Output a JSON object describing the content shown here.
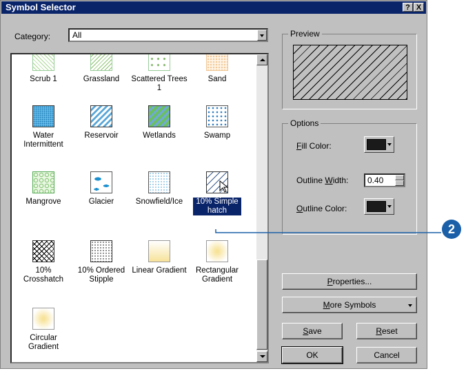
{
  "window": {
    "title": "Symbol Selector",
    "help_btn": "?",
    "close_btn": "X"
  },
  "category": {
    "label": "Category:",
    "value": "All"
  },
  "symbols": [
    {
      "label": "Scrub 1"
    },
    {
      "label": "Grassland"
    },
    {
      "label": "Scattered Trees 1"
    },
    {
      "label": "Sand"
    },
    {
      "label": "Water Intermittent"
    },
    {
      "label": "Reservoir"
    },
    {
      "label": "Wetlands"
    },
    {
      "label": "Swamp"
    },
    {
      "label": "Mangrove"
    },
    {
      "label": "Glacier"
    },
    {
      "label": "Snowfield/Ice"
    },
    {
      "label": "10% Simple hatch"
    },
    {
      "label": "10% Crosshatch"
    },
    {
      "label": "10% Ordered Stipple"
    },
    {
      "label": "Linear Gradient"
    },
    {
      "label": "Rectangular Gradient"
    },
    {
      "label": "Circular Gradient"
    }
  ],
  "selected_symbol": "10% Simple hatch",
  "preview": {
    "caption": "Preview"
  },
  "options": {
    "caption": "Options",
    "fill_color": {
      "label_pre": "",
      "label_key": "F",
      "label_post": "ill Color:",
      "color": "#1a1a1a"
    },
    "outline_width": {
      "label_pre": "Outline ",
      "label_key": "W",
      "label_post": "idth:",
      "value": "0.40"
    },
    "outline_color": {
      "label_pre": "",
      "label_key": "O",
      "label_post": "utline Color:",
      "color": "#1a1a1a"
    }
  },
  "buttons": {
    "properties": {
      "pre": "",
      "key": "P",
      "post": "roperties..."
    },
    "more_symbols": {
      "pre": "",
      "key": "M",
      "post": "ore Symbols"
    },
    "save": {
      "pre": "",
      "key": "S",
      "post": "ave"
    },
    "reset": {
      "pre": "",
      "key": "R",
      "post": "eset"
    },
    "ok": "OK",
    "cancel": "Cancel"
  },
  "callout": {
    "number": "2",
    "color": "#1a5fa8"
  }
}
